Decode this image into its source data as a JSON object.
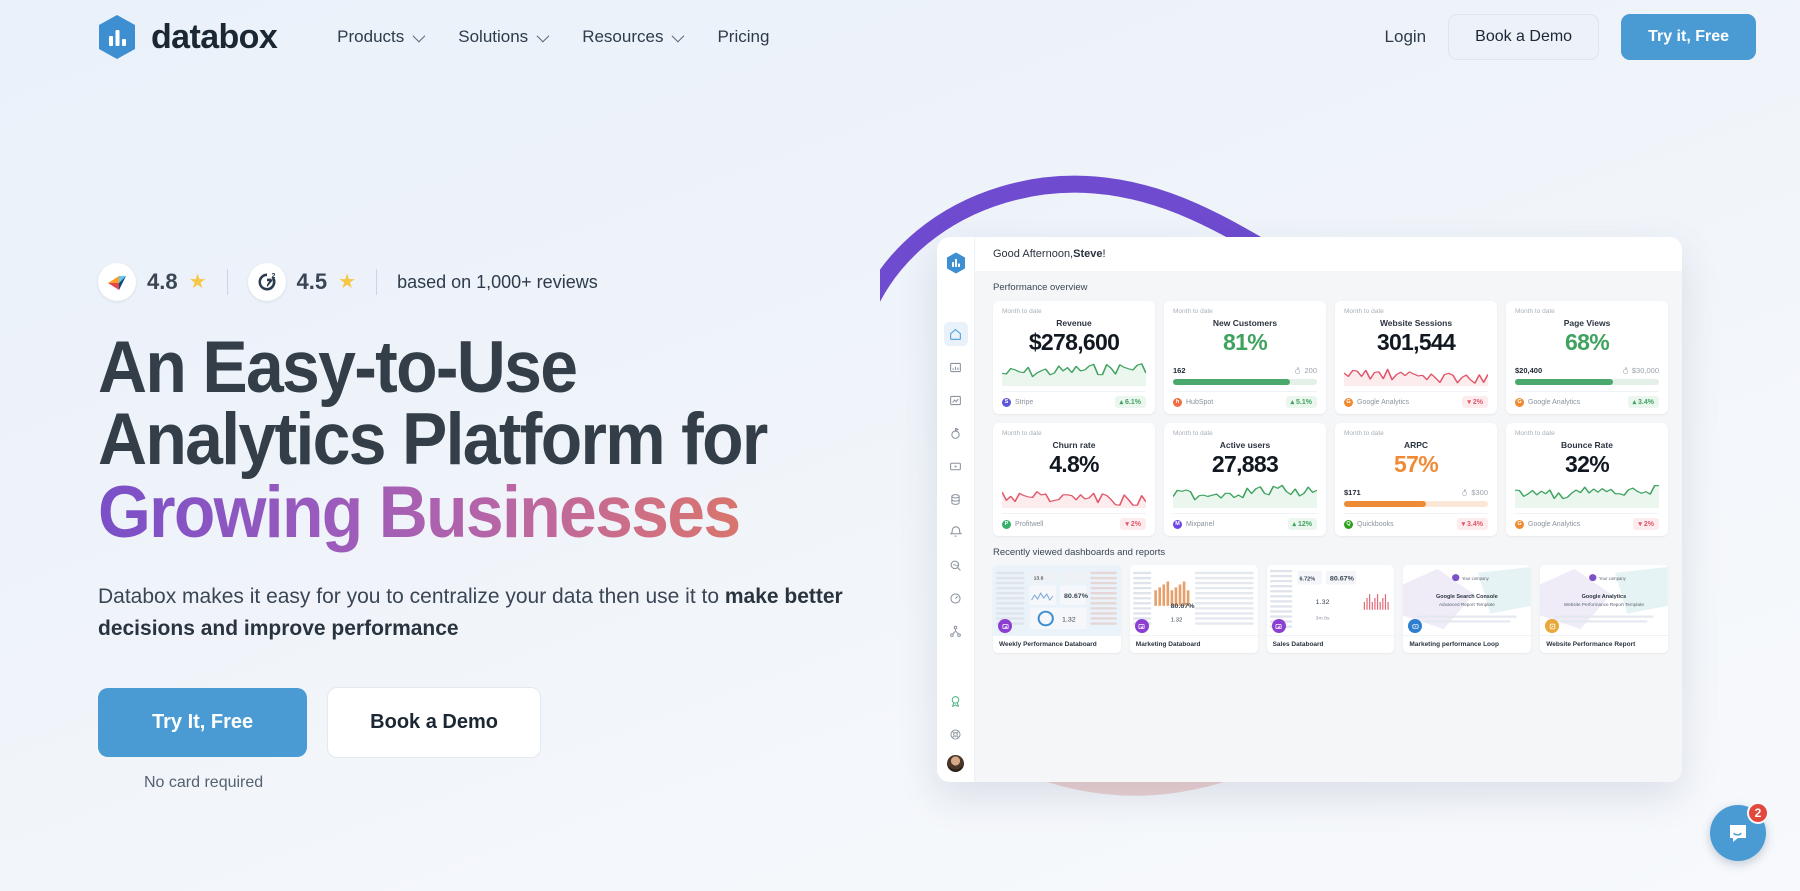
{
  "header": {
    "logo_text": "databox",
    "nav": [
      {
        "label": "Products",
        "caret": true
      },
      {
        "label": "Solutions",
        "caret": true
      },
      {
        "label": "Resources",
        "caret": true
      },
      {
        "label": "Pricing",
        "caret": false
      }
    ],
    "login_label": "Login",
    "demo_label": "Book a Demo",
    "try_label": "Try it, Free"
  },
  "hero": {
    "ratings": [
      {
        "source": "capterra",
        "value": "4.8"
      },
      {
        "source": "g2",
        "value": "4.5"
      }
    ],
    "reviews_text": "based on 1,000+ reviews",
    "headline_line1": "An Easy-to-Use",
    "headline_line2": "Analytics Platform for",
    "headline_line3": "Growing Businesses",
    "sub_text_1": "Databox makes it easy for you to centralize your data then use it to ",
    "sub_text_bold": "make better decisions and improve performance",
    "cta_primary": "Try It, Free",
    "cta_secondary": "Book a Demo",
    "cta_note": "No card required"
  },
  "colors": {
    "brand_blue": "#4a9bd4",
    "gradient_start": "#7a4fc7",
    "gradient_end": "#d8756d",
    "positive": "#3fa35f",
    "negative": "#e2566a",
    "orange": "#ef8b36",
    "swoosh_purple": "#6f4bd0",
    "swoosh_pink": "#e9cacb"
  },
  "dashboard": {
    "greeting": "Good Afternoon, ",
    "greeting_name": "Steve",
    "greeting_end": "!",
    "section_title": "Performance overview",
    "sidebar_icons": [
      "home-icon",
      "databoard-icon",
      "report-icon",
      "goals-icon",
      "loop-icon",
      "database-icon",
      "alerts-icon",
      "query-icon",
      "performance-icon",
      "hierarchy-icon"
    ],
    "sidebar_bottom_icons": [
      "badge-icon",
      "help-icon",
      "avatar"
    ],
    "kpis": [
      {
        "period": "Month to date",
        "name": "Revenue",
        "value": "$278,600",
        "value_color": "dark",
        "chart": "spark-green",
        "source": "Stripe",
        "source_color": "#5b57d8",
        "source_initial": "S",
        "delta": "6.1%",
        "direction": "up"
      },
      {
        "period": "Month to date",
        "name": "New Customers",
        "value": "81%",
        "value_color": "green",
        "chart": "progress-green",
        "goal_current": "162",
        "goal_target": "200",
        "progress_pct": 81,
        "source": "HubSpot",
        "source_color": "#ef6f43",
        "source_initial": "h",
        "delta": "5.1%",
        "direction": "up"
      },
      {
        "period": "Month to date",
        "name": "Website Sessions",
        "value": "301,544",
        "value_color": "dark",
        "chart": "spark-red",
        "source": "Google Analytics",
        "source_color": "#f0892f",
        "source_initial": "G",
        "delta": "2%",
        "direction": "down"
      },
      {
        "period": "Month to date",
        "name": "Page Views",
        "value": "68%",
        "value_color": "green",
        "chart": "progress-green",
        "goal_current": "$20,400",
        "goal_target": "$30,000",
        "progress_pct": 68,
        "source": "Google Analytics",
        "source_color": "#f0892f",
        "source_initial": "G",
        "delta": "3.4%",
        "direction": "up"
      },
      {
        "period": "Month to date",
        "name": "Churn rate",
        "value": "4.8%",
        "value_color": "dark",
        "chart": "spark-red",
        "source": "Profitwell",
        "source_color": "#37b06a",
        "source_initial": "P",
        "delta": "2%",
        "direction": "down"
      },
      {
        "period": "Month to date",
        "name": "Active users",
        "value": "27,883",
        "value_color": "dark",
        "chart": "spark-green",
        "source": "Mixpanel",
        "source_color": "#6b46e5",
        "source_initial": "M",
        "delta": "12%",
        "direction": "up"
      },
      {
        "period": "Month to date",
        "name": "ARPC",
        "value": "57%",
        "value_color": "orange",
        "chart": "progress-orange",
        "goal_current": "$171",
        "goal_target": "$300",
        "progress_pct": 57,
        "source": "Quickbooks",
        "source_color": "#2ca01c",
        "source_initial": "Q",
        "delta": "3.4%",
        "direction": "down"
      },
      {
        "period": "Month to date",
        "name": "Bounce Rate",
        "value": "32%",
        "value_color": "dark",
        "chart": "spark-green",
        "source": "Google Analytics",
        "source_color": "#f0892f",
        "source_initial": "G",
        "delta": "2%",
        "direction": "down"
      }
    ],
    "recent_title": "Recently viewed dashboards and reports",
    "recent_items": [
      {
        "label": "Weekly Performance Databoard",
        "badge_color": "#8b3fd0",
        "type": "databoard"
      },
      {
        "label": "Marketing Databoard",
        "badge_color": "#8b3fd0",
        "type": "databoard"
      },
      {
        "label": "Sales Databoard",
        "badge_color": "#8b3fd0",
        "type": "databoard"
      },
      {
        "label": "Marketing performance Loop",
        "badge_color": "#2f7fd0",
        "type": "loop",
        "title": "Google Search Console",
        "subtitle": "Advanced Report Template",
        "brand": "Your company"
      },
      {
        "label": "Website Performance Report",
        "badge_color": "#e8a93a",
        "type": "report",
        "title": "Google Analytics",
        "subtitle": "Website Performance Report Template",
        "brand": "Your company"
      }
    ]
  },
  "intercom": {
    "badge_count": "2",
    "icon": "chat-icon"
  }
}
